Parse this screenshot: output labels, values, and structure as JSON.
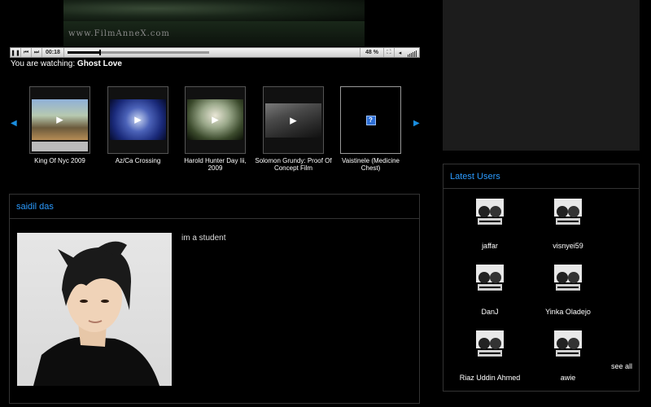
{
  "player": {
    "watermark": "www.FilmAnneX.com",
    "time": "00:18",
    "volume": "48 %",
    "progress": 0.19
  },
  "watching": {
    "prefix": "You are watching:",
    "title": "Ghost Love"
  },
  "carousel": {
    "items": [
      {
        "label": "King Of Nyc 2009"
      },
      {
        "label": "Az/Ca Crossing"
      },
      {
        "label": "Harold Hunter Day Iii, 2009"
      },
      {
        "label": "Solomon Grundy: Proof Of Concept Film"
      },
      {
        "label": "Vaistinele (Medicine Chest)"
      }
    ]
  },
  "profile": {
    "name": "saidil das",
    "description": "im a student"
  },
  "latest_users": {
    "title": "Latest Users",
    "users": [
      {
        "name": "jaffar"
      },
      {
        "name": "visnyei59"
      },
      {
        "name": "DanJ"
      },
      {
        "name": "Yinka Oladejo"
      },
      {
        "name": "Riaz Uddin Ahmed"
      },
      {
        "name": "awie"
      }
    ],
    "see_all": "see all"
  },
  "colors": {
    "accent": "#2b9bff",
    "background": "#000000",
    "ad_box": "#1c1c1c"
  }
}
